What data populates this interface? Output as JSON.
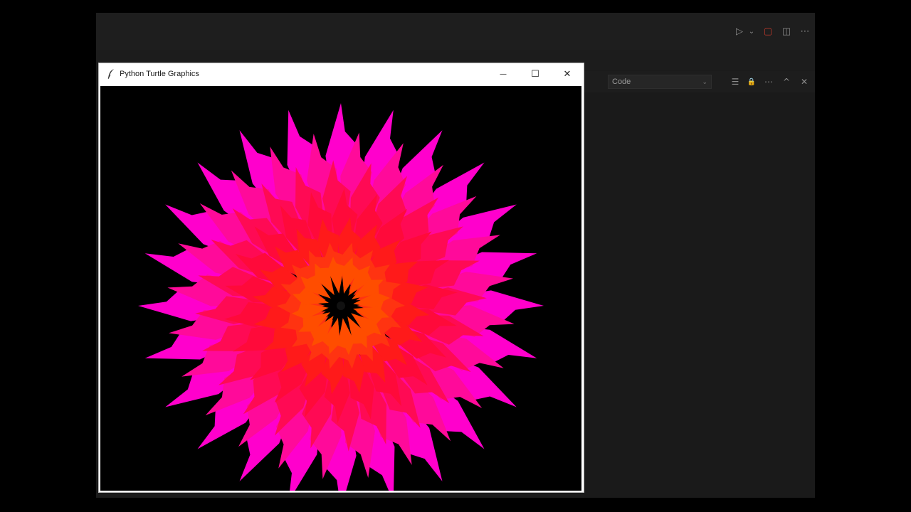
{
  "editor": {
    "top_actions": [
      {
        "icon": "run-icon",
        "glyph": "▷"
      },
      {
        "icon": "chevron-down-icon",
        "glyph": "⌄"
      },
      {
        "icon": "stop-icon",
        "glyph": "▢",
        "color": "#c0392b"
      },
      {
        "icon": "split-editor-icon",
        "glyph": "◫"
      },
      {
        "icon": "more-icon",
        "glyph": "⋯"
      }
    ],
    "panel": {
      "dropdown_value": "Code",
      "dropdown_chevron": "⌄",
      "icons": [
        {
          "icon": "filter-icon",
          "glyph": "☰"
        },
        {
          "icon": "lock-icon",
          "glyph": "🔒"
        },
        {
          "icon": "more-icon",
          "glyph": "⋯"
        },
        {
          "icon": "chevron-up-icon",
          "glyph": "^"
        },
        {
          "icon": "close-icon",
          "glyph": "✕"
        }
      ]
    }
  },
  "turtle_window": {
    "title": "Python Turtle Graphics",
    "minimize_glyph": "—",
    "maximize_glyph": "☐",
    "close_glyph": "✕",
    "canvas": {
      "background": "#000000",
      "colors": {
        "outer": "#ff00cc",
        "middle": "#ff0a54",
        "inner": "#ff1a1a",
        "core": "#ff4d00"
      }
    }
  }
}
